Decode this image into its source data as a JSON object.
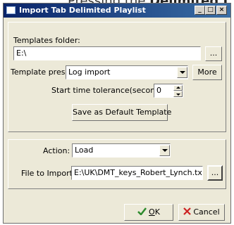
{
  "background_caption": {
    "lead": "Pressing the ",
    "bold": "Delimited L"
  },
  "window": {
    "title": "Import Tab Delimited Playlist",
    "controls": {
      "minimize": "_",
      "maximize": "□",
      "close": "×"
    }
  },
  "templates_folder": {
    "label": "Templates folder:",
    "value": "E:\\",
    "browse_label": "..."
  },
  "template_preset": {
    "label": "Template preset:",
    "value": "Log import",
    "more_label": "More"
  },
  "tolerance": {
    "label": "Start time tolerance(seconds):",
    "value": "0"
  },
  "save_default_label": "Save as Default Template",
  "action": {
    "label": "Action:",
    "value": "Load"
  },
  "file_to_import": {
    "label": "File to Import:",
    "value": "E:\\UK\\DMT_keys_Robert_Lynch.txt",
    "browse_label": "..."
  },
  "ok_button": {
    "mnemonic": "O",
    "rest": "K",
    "icon": "checkmark-icon",
    "icon_color": "#2e8b2e"
  },
  "cancel_button": {
    "label": "Cancel",
    "icon": "x-icon",
    "icon_color": "#cc2222"
  }
}
